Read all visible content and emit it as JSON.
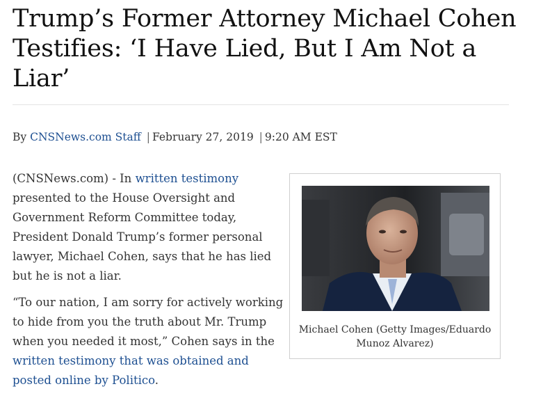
{
  "article": {
    "headline": "Trump’s Former Attorney Michael Cohen Testifies: ‘I Have Lied, But I Am Not a Liar’",
    "byline": {
      "prefix": "By",
      "author": "CNSNews.com Staff",
      "separator": "|",
      "date": "February 27, 2019",
      "time": "9:20 AM EST"
    },
    "paragraph1": {
      "lead": "(CNSNews.com) - In ",
      "link": "written testimony",
      "rest": " presented to the House Oversight and Government Reform Committee today, President Donald Trump’s former personal lawyer, Michael Cohen, says that he has lied but he is not a liar."
    },
    "paragraph2": {
      "lead": "“To our nation, I am sorry for actively working to hide from you the truth about Mr. Trump when you needed it most,” Cohen says in the ",
      "link": "written testimony that was obtained and posted online by Politico",
      "end": "."
    },
    "figure": {
      "caption": "Michael Cohen (Getty Images/Eduardo Munoz Alvarez)"
    }
  },
  "colors": {
    "link": "#1d4f91",
    "text": "#333333",
    "headline": "#111111"
  }
}
